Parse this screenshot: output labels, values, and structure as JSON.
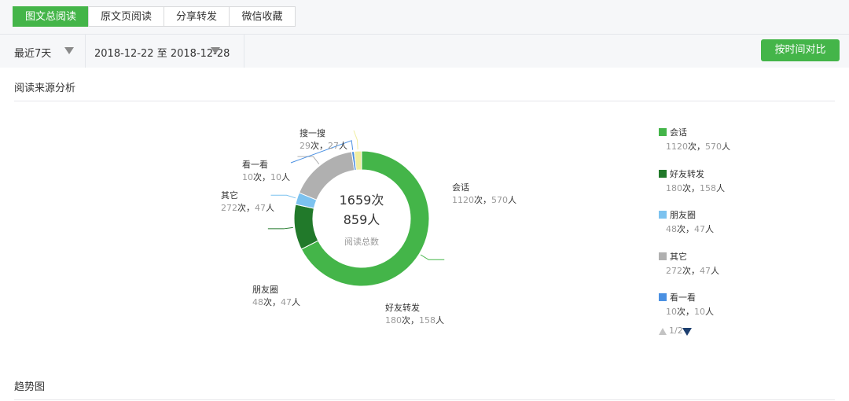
{
  "tabs": [
    {
      "label": "图文总阅读",
      "active": true
    },
    {
      "label": "原文页阅读",
      "active": false
    },
    {
      "label": "分享转发",
      "active": false
    },
    {
      "label": "微信收藏",
      "active": false
    }
  ],
  "filters": {
    "range": "最近7天",
    "date_start": "2018-12-22",
    "date_sep": "至",
    "date_end": "2018-12-28",
    "compare_button": "按时间对比"
  },
  "sections": {
    "source_title": "阅读来源分析",
    "trend_title": "趋势图"
  },
  "chart_data": {
    "type": "pie",
    "variant": "donut",
    "center": {
      "line1": "1659次",
      "line2": "859人",
      "caption": "阅读总数"
    },
    "value_unit": "次",
    "user_unit": "人",
    "series": [
      {
        "name": "会话",
        "value": 1120,
        "users": 570,
        "color": "#44b549"
      },
      {
        "name": "好友转发",
        "value": 180,
        "users": 158,
        "color": "#21792a"
      },
      {
        "name": "朋友圈",
        "value": 48,
        "users": 47,
        "color": "#7cc2ef"
      },
      {
        "name": "其它",
        "value": 272,
        "users": 47,
        "color": "#b0b0b0"
      },
      {
        "name": "看一看",
        "value": 10,
        "users": 10,
        "color": "#4a90e2"
      },
      {
        "name": "搜一搜",
        "value": 29,
        "users": 27,
        "color": "#f0eea0"
      }
    ],
    "legend": {
      "position": "right",
      "items": [
        {
          "name": "会话",
          "value": 1120,
          "users": 570,
          "color": "#44b549"
        },
        {
          "name": "好友转发",
          "value": 180,
          "users": 158,
          "color": "#21792a"
        },
        {
          "name": "朋友圈",
          "value": 48,
          "users": 47,
          "color": "#7cc2ef"
        },
        {
          "name": "其它",
          "value": 272,
          "users": 47,
          "color": "#b0b0b0"
        },
        {
          "name": "看一看",
          "value": 10,
          "users": 10,
          "color": "#4a90e2"
        }
      ],
      "page": "1/2"
    }
  }
}
